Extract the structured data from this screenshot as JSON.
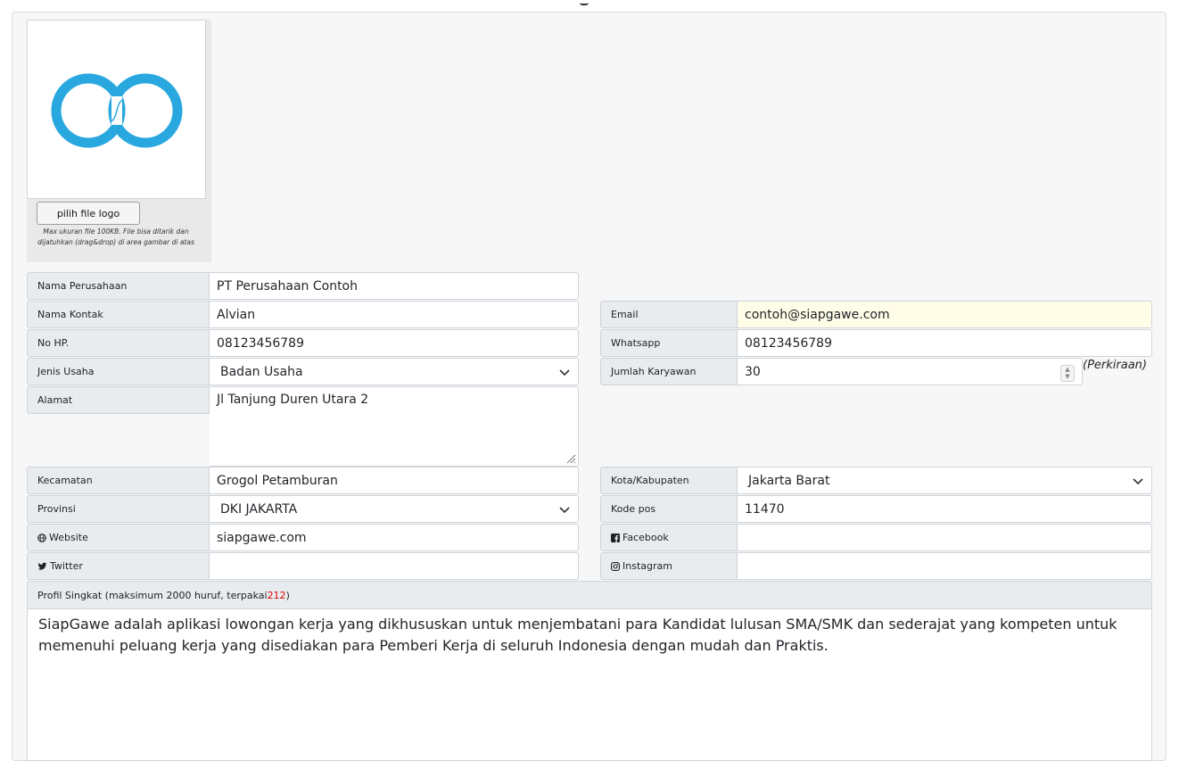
{
  "logo": {
    "button_label": "pilih file logo",
    "hint": "Max ukuran file 100KB. File bisa ditarik dan dijatuhkan (drag&drop) di area gambar di atas",
    "brand_color": "#29a8e0"
  },
  "form": {
    "nama_perusahaan": {
      "label": "Nama Perusahaan",
      "value": "PT Perusahaan Contoh"
    },
    "nama_kontak": {
      "label": "Nama Kontak",
      "value": "Alvian"
    },
    "email": {
      "label": "Email",
      "value": "contoh@siapgawe.com"
    },
    "no_hp": {
      "label": "No HP.",
      "value": "08123456789"
    },
    "whatsapp": {
      "label": "Whatsapp",
      "value": "08123456789"
    },
    "jenis_usaha": {
      "label": "Jenis Usaha",
      "value": "Badan Usaha"
    },
    "jumlah_karyawan": {
      "label": "Jumlah Karyawan",
      "value": "30",
      "note": "(Perkiraan)"
    },
    "alamat": {
      "label": "Alamat",
      "value": "Jl Tanjung Duren Utara 2"
    },
    "kecamatan": {
      "label": "Kecamatan",
      "value": "Grogol Petamburan"
    },
    "kota": {
      "label": "Kota/Kabupaten",
      "value": "Jakarta Barat"
    },
    "provinsi": {
      "label": "Provinsi",
      "value": "DKI JAKARTA"
    },
    "kode_pos": {
      "label": "Kode pos",
      "value": "11470"
    },
    "website": {
      "label": "Website",
      "value": "siapgawe.com",
      "icon": "globe-icon"
    },
    "facebook": {
      "label": "Facebook",
      "value": "",
      "icon": "facebook-icon"
    },
    "twitter": {
      "label": "Twitter",
      "value": "",
      "icon": "twitter-icon"
    },
    "instagram": {
      "label": "Instagram",
      "value": "",
      "icon": "instagram-icon"
    }
  },
  "profil": {
    "label_prefix": "Profil Singkat (maksimum 2000 huruf, terpakai ",
    "count": "212",
    "label_suffix": ")",
    "text": "SiapGawe adalah aplikasi lowongan kerja yang dikhususkan untuk menjembatani para Kandidat lulusan SMA/SMK dan sederajat yang kompeten untuk memenuhi peluang kerja yang disediakan para Pemberi Kerja di seluruh Indonesia dengan mudah dan Praktis."
  }
}
